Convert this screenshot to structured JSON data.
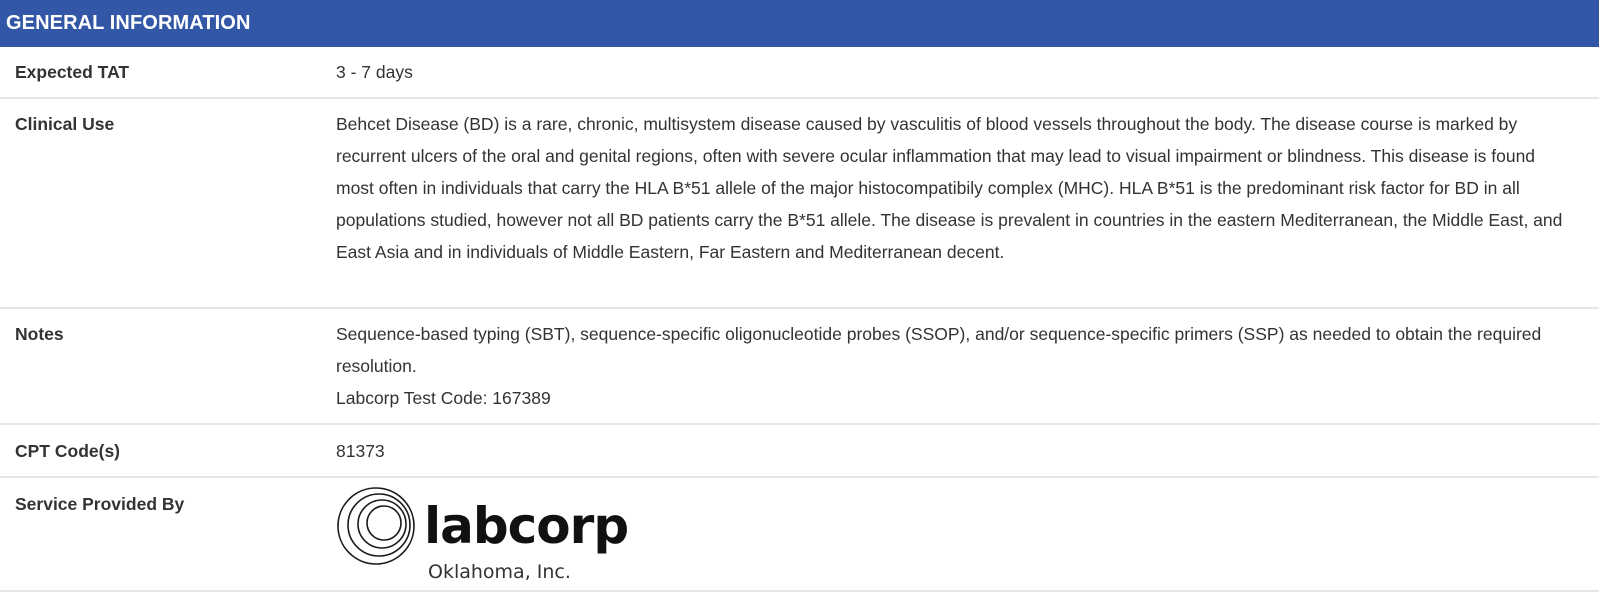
{
  "header": {
    "title": "GENERAL INFORMATION"
  },
  "rows": {
    "tat": {
      "label": "Expected TAT",
      "value": "3 - 7 days"
    },
    "clinical": {
      "label": "Clinical Use",
      "value": "Behcet Disease (BD) is a rare, chronic, multisystem disease caused by vasculitis of blood vessels throughout the body. The disease course is marked by recurrent ulcers of the oral and genital regions, often with severe ocular inflammation that may lead to visual impairment or blindness. This disease is found most often in individuals that carry the HLA B*51 allele of the major histocompatibily complex (MHC). HLA B*51 is the predominant risk factor for BD in all populations studied, however not all BD patients carry the B*51 allele. The disease is prevalent in countries in the eastern Mediterranean, the Middle East, and East Asia and in individuals of Middle Eastern, Far Eastern and Mediterranean decent."
    },
    "notes": {
      "label": "Notes",
      "line1": "Sequence-based typing (SBT), sequence-specific oligonucleotide probes (SSOP), and/or sequence-specific primers (SSP) as needed to obtain the required resolution.",
      "line2": "Labcorp Test Code: 167389"
    },
    "cpt": {
      "label": "CPT Code(s)",
      "value": "81373"
    },
    "service": {
      "label": "Service Provided By",
      "logo_name": "labcorp",
      "logo_subtitle": "Oklahoma, Inc."
    }
  },
  "colors": {
    "header_bg": "#3157a6",
    "header_text": "#ffffff",
    "body_text": "#333333",
    "divider": "#e6e6e6"
  }
}
